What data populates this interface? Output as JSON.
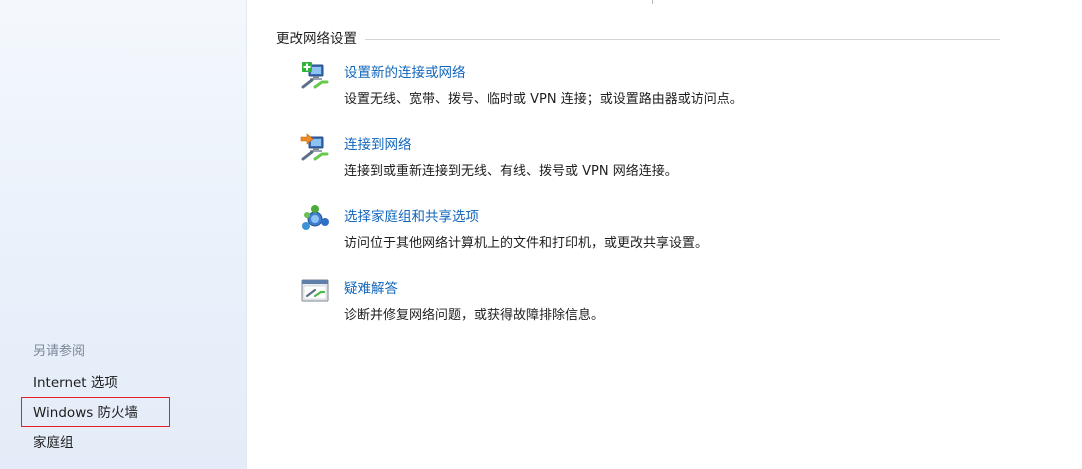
{
  "left_pane": {
    "see_also_heading": "另请参阅",
    "links": [
      {
        "label": "Internet 选项"
      },
      {
        "label": "Windows 防火墙"
      },
      {
        "label": "家庭组"
      }
    ],
    "highlight_color": "#e0202a"
  },
  "main": {
    "section_title": "更改网络设置",
    "tasks": [
      {
        "icon": "new-connection-network-icon",
        "title": "设置新的连接或网络",
        "description": "设置无线、宽带、拨号、临时或 VPN 连接；或设置路由器或访问点。"
      },
      {
        "icon": "connect-to-network-icon",
        "title": "连接到网络",
        "description": "连接到或重新连接到无线、有线、拨号或 VPN 网络连接。"
      },
      {
        "icon": "homegroup-sharing-icon",
        "title": "选择家庭组和共享选项",
        "description": "访问位于其他网络计算机上的文件和打印机，或更改共享设置。"
      },
      {
        "icon": "troubleshoot-icon",
        "title": "疑难解答",
        "description": "诊断并修复网络问题，或获得故障排除信息。"
      }
    ],
    "link_color": "#1166bb"
  }
}
